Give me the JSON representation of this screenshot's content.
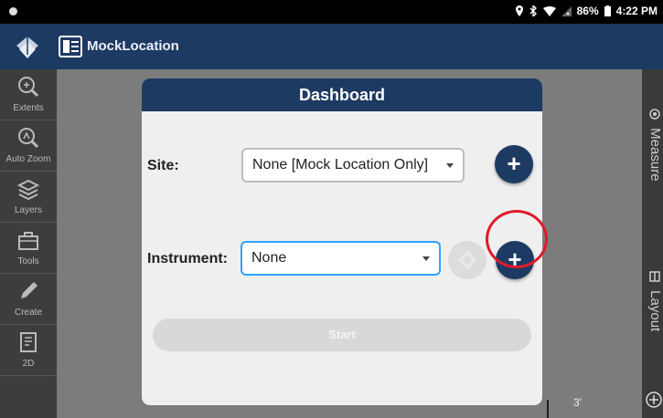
{
  "status_bar": {
    "battery": "86%",
    "time": "4:22 PM"
  },
  "app_bar": {
    "title": "MockLocation"
  },
  "sidebar": {
    "items": [
      {
        "label": "Extents",
        "icon": "zoom-extents-icon"
      },
      {
        "label": "Auto Zoom",
        "icon": "auto-zoom-icon"
      },
      {
        "label": "Layers",
        "icon": "layers-icon"
      },
      {
        "label": "Tools",
        "icon": "toolbox-icon"
      },
      {
        "label": "Create",
        "icon": "pencil-icon"
      },
      {
        "label": "2D",
        "icon": "view-2d-icon"
      }
    ]
  },
  "right_tabs": {
    "measure": "Measure",
    "layout": "Layout"
  },
  "dialog": {
    "title": "Dashboard",
    "site_label": "Site:",
    "site_value": "None [Mock Location Only]",
    "add_site": "+",
    "instrument_label": "Instrument:",
    "instrument_value": "None",
    "add_instrument": "+",
    "start_label": "Start"
  },
  "map": {
    "scale_text": "3'"
  },
  "colors": {
    "primary": "#1d3a63",
    "highlight": "#e01b2a",
    "focus": "#2ea3ff"
  }
}
